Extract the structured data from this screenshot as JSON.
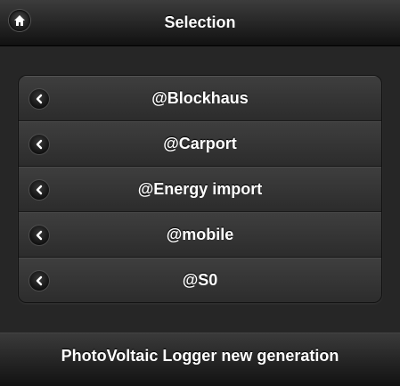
{
  "header": {
    "title": "Selection",
    "home_icon": "home-icon"
  },
  "list": {
    "items": [
      {
        "label": "@Blockhaus",
        "icon": "chevron-left-icon"
      },
      {
        "label": "@Carport",
        "icon": "chevron-left-icon"
      },
      {
        "label": "@Energy import",
        "icon": "chevron-left-icon"
      },
      {
        "label": "@mobile",
        "icon": "chevron-left-icon"
      },
      {
        "label": "@S0",
        "icon": "chevron-left-icon"
      }
    ]
  },
  "footer": {
    "title": "PhotoVoltaic Logger new generation"
  },
  "colors": {
    "background": "#262626",
    "text": "#ffffff"
  }
}
